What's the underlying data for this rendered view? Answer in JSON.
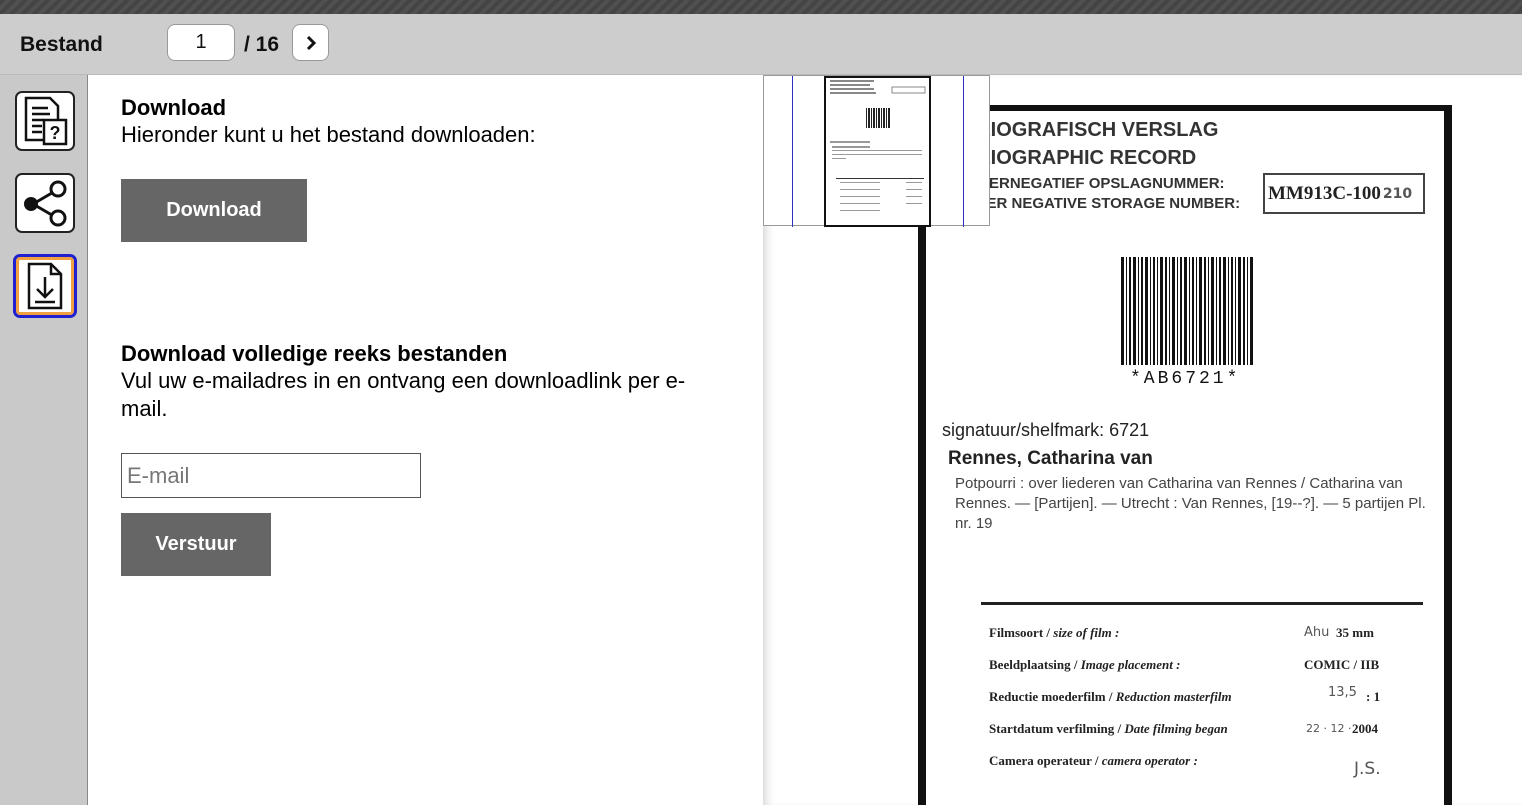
{
  "toolbar": {
    "title": "Bestand",
    "page_current": "1",
    "page_total": "/ 16"
  },
  "sidebar": {
    "buttons": [
      {
        "name": "info",
        "icon": "document-question-icon"
      },
      {
        "name": "share",
        "icon": "share-icon"
      },
      {
        "name": "download",
        "icon": "download-icon",
        "active": true
      }
    ]
  },
  "panel": {
    "download_heading": "Download",
    "download_text": "Hieronder kunt u het bestand downloaden:",
    "download_button": "Download",
    "series_heading": "Download volledige reeks bestanden",
    "series_text": "Vul uw e-mailadres in en ontvang een downloadlink per e-mail.",
    "email_placeholder": "E-mail",
    "send_button": "Verstuur"
  },
  "document": {
    "title_line1": "BIBLIOGRAFISCH VERSLAG",
    "title_line2": "BIBLIOGRAPHIC RECORD",
    "storage_line1": "MOEDERNEGATIEF OPSLAGNUMMER:",
    "storage_line2": "MASTER NEGATIVE STORAGE NUMBER:",
    "storage_number": "MM913C-100",
    "storage_hand": "210",
    "barcode_text": "*AB6721*",
    "shelfmark": "signatuur/shelfmark:  6721",
    "author": "Rennes, Catharina van",
    "description": "Potpourri : over liederen van Catharina van Rennes / Catharina van Rennes. — [Partijen]. — Utrecht : Van Rennes, [19--?]. — 5 partijen Pl. nr. 19",
    "film_rows": [
      {
        "label": "Filmsoort / ",
        "label_en": "size of film :",
        "hand": "Ahu",
        "value": "35  mm"
      },
      {
        "label": "Beeldplaatsing / ",
        "label_en": "Image placement :",
        "hand": "",
        "value": "COMIC / IIB"
      },
      {
        "label": "Reductie moederfilm / ",
        "label_en": "Reduction masterfilm",
        "hand": "13,5",
        "value": ": 1"
      },
      {
        "label": "Startdatum verfilming / ",
        "label_en": "Date filming began",
        "hand": "22 · 12 ·",
        "value": "2004"
      },
      {
        "label": "Camera operateur / ",
        "label_en": "camera operator :",
        "hand": "J.S.",
        "value": ""
      }
    ]
  },
  "colors": {
    "toolbar_bg": "#cdcdcd",
    "sidebar_bg": "#c9c9c9",
    "button_bg": "#666666",
    "active_border": "#2020d0",
    "active_inner": "#f0a040"
  }
}
